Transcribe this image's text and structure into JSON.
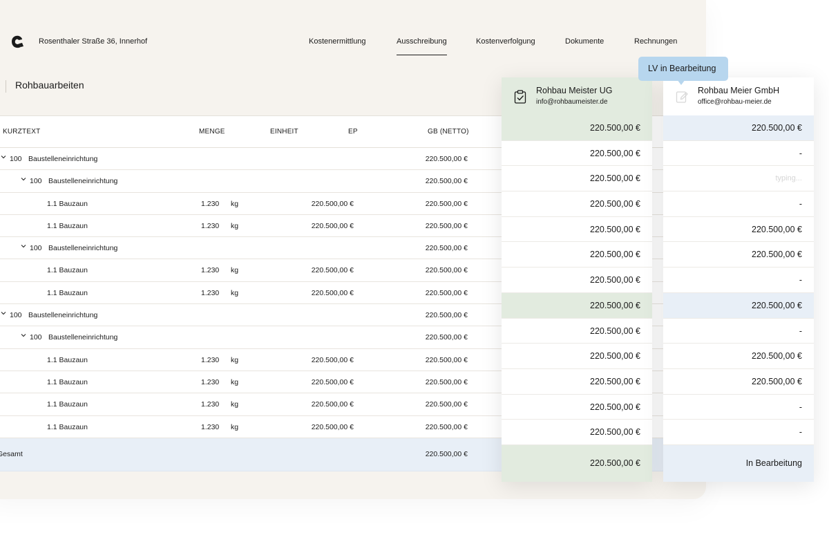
{
  "header": {
    "address": "Rosenthaler Straße 36, Innerhof",
    "nav": [
      {
        "label": "Kostenermittlung"
      },
      {
        "label": "Ausschreibung"
      },
      {
        "label": "Kostenverfolgung"
      },
      {
        "label": "Dokumente"
      },
      {
        "label": "Rechnungen"
      }
    ]
  },
  "section": {
    "title": "Rohbauarbeiten"
  },
  "table": {
    "columns": {
      "kurztext": "KURZTEXT",
      "menge": "MENGE",
      "einheit": "EINHEIT",
      "ep": "EP",
      "gb": "GB (NETTO)"
    },
    "rows": [
      {
        "num": "100",
        "text": "Baustelleneinrichtung",
        "qty": "",
        "unit": "",
        "ep": "",
        "gb": "220.500,00 €"
      },
      {
        "num": "100",
        "text": "Baustelleneinrichtung",
        "qty": "",
        "unit": "",
        "ep": "",
        "gb": "220.500,00 €"
      },
      {
        "num": "",
        "text": "1.1 Bauzaun",
        "qty": "1.230",
        "unit": "kg",
        "ep": "220.500,00 €",
        "gb": "220.500,00 €"
      },
      {
        "num": "",
        "text": "1.1 Bauzaun",
        "qty": "1.230",
        "unit": "kg",
        "ep": "220.500,00 €",
        "gb": "220.500,00 €"
      },
      {
        "num": "100",
        "text": "Baustelleneinrichtung",
        "qty": "",
        "unit": "",
        "ep": "",
        "gb": "220.500,00 €"
      },
      {
        "num": "",
        "text": "1.1 Bauzaun",
        "qty": "1.230",
        "unit": "kg",
        "ep": "220.500,00 €",
        "gb": "220.500,00 €"
      },
      {
        "num": "",
        "text": "1.1 Bauzaun",
        "qty": "1.230",
        "unit": "kg",
        "ep": "220.500,00 €",
        "gb": "220.500,00 €"
      },
      {
        "num": "100",
        "text": "Baustelleneinrichtung",
        "qty": "",
        "unit": "",
        "ep": "",
        "gb": "220.500,00 €"
      },
      {
        "num": "100",
        "text": "Baustelleneinrichtung",
        "qty": "",
        "unit": "",
        "ep": "",
        "gb": "220.500,00 €"
      },
      {
        "num": "",
        "text": "1.1 Bauzaun",
        "qty": "1.230",
        "unit": "kg",
        "ep": "220.500,00 €",
        "gb": "220.500,00 €"
      },
      {
        "num": "",
        "text": "1.1 Bauzaun",
        "qty": "1.230",
        "unit": "kg",
        "ep": "220.500,00 €",
        "gb": "220.500,00 €"
      },
      {
        "num": "",
        "text": "1.1 Bauzaun",
        "qty": "1.230",
        "unit": "kg",
        "ep": "220.500,00 €",
        "gb": "220.500,00 €"
      },
      {
        "num": "",
        "text": "1.1 Bauzaun",
        "qty": "1.230",
        "unit": "kg",
        "ep": "220.500,00 €",
        "gb": "220.500,00 €"
      }
    ],
    "total": {
      "label": "Gesamt",
      "gb": "220.500,00 €"
    }
  },
  "bidders": [
    {
      "name": "Rohbau Meister UG",
      "email": "info@rohbaumeister.de",
      "icon": "clipboard-check-icon",
      "cells": [
        "220.500,00 €",
        "220.500,00 €",
        "220.500,00 €",
        "220.500,00 €",
        "220.500,00 €",
        "220.500,00 €",
        "220.500,00 €",
        "220.500,00 €",
        "220.500,00 €",
        "220.500,00 €",
        "220.500,00 €",
        "220.500,00 €",
        "220.500,00 €"
      ],
      "total": "220.500,00 €"
    },
    {
      "name": "Rohbau Meier GmbH",
      "email": "office@rohbau-meier.de",
      "icon": "edit-document-icon",
      "cells": [
        "220.500,00 €",
        "-",
        "typing...",
        "-",
        "220.500,00 €",
        "220.500,00 €",
        "-",
        "220.500,00 €",
        "-",
        "220.500,00 €",
        "220.500,00 €",
        "-",
        "-"
      ],
      "total": "In Bearbeitung"
    }
  ],
  "tooltip": {
    "label": "LV in Bearbeitung"
  },
  "colors": {
    "background": "#f6f3ee",
    "green_highlight": "#e2ebdf",
    "blue_highlight": "#e8eff7",
    "tooltip": "#b7d6ee"
  }
}
